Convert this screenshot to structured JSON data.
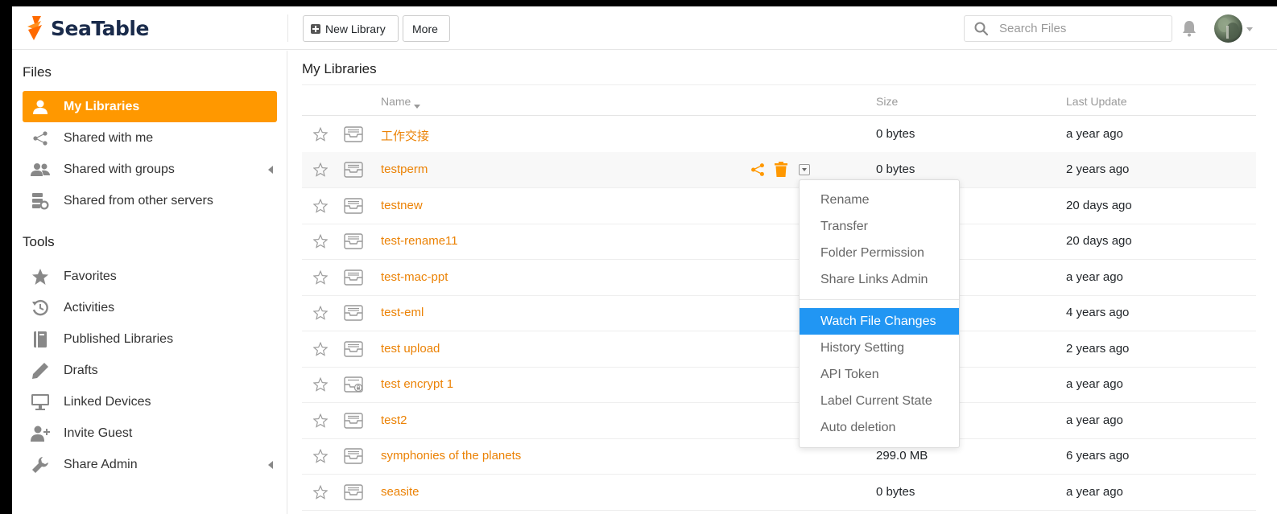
{
  "header": {
    "brand": "SeaTable",
    "new_library_label": "New Library",
    "more_label": "More",
    "search_placeholder": "Search Files"
  },
  "sidebar": {
    "files_heading": "Files",
    "files_items": [
      {
        "label": "My Libraries",
        "icon": "user-icon",
        "active": true
      },
      {
        "label": "Shared with me",
        "icon": "share-icon"
      },
      {
        "label": "Shared with groups",
        "icon": "group-icon"
      },
      {
        "label": "Shared from other servers",
        "icon": "server-share-icon"
      }
    ],
    "tools_heading": "Tools",
    "tools_items": [
      {
        "label": "Favorites",
        "icon": "star-icon"
      },
      {
        "label": "Activities",
        "icon": "history-icon"
      },
      {
        "label": "Published Libraries",
        "icon": "book-icon"
      },
      {
        "label": "Drafts",
        "icon": "pencil-icon"
      },
      {
        "label": "Linked Devices",
        "icon": "monitor-icon"
      },
      {
        "label": "Invite Guest",
        "icon": "add-user-icon"
      },
      {
        "label": "Share Admin",
        "icon": "wrench-icon"
      }
    ]
  },
  "main": {
    "title": "My Libraries",
    "columns": {
      "name": "Name",
      "size": "Size",
      "last_update": "Last Update"
    },
    "rows": [
      {
        "name": "工作交接",
        "size": "0 bytes",
        "updated": "a year ago"
      },
      {
        "name": "testperm",
        "size": "0 bytes",
        "updated": "2 years ago"
      },
      {
        "name": "testnew",
        "size": "",
        "updated": "20 days ago"
      },
      {
        "name": "test-rename11",
        "size": "",
        "updated": "20 days ago"
      },
      {
        "name": "test-mac-ppt",
        "size": "",
        "updated": "a year ago"
      },
      {
        "name": "test-eml",
        "size": "",
        "updated": "4 years ago"
      },
      {
        "name": "test upload",
        "size": "",
        "updated": "2 years ago"
      },
      {
        "name": "test encrypt 1",
        "size": "",
        "updated": "a year ago",
        "encrypted": true
      },
      {
        "name": "test2",
        "size": "",
        "updated": "a year ago"
      },
      {
        "name": "symphonies of the planets",
        "size": "299.0 MB",
        "updated": "6 years ago"
      },
      {
        "name": "seasite",
        "size": "0 bytes",
        "updated": "a year ago"
      }
    ]
  },
  "dropdown": {
    "items": [
      "Rename",
      "Transfer",
      "Folder Permission",
      "Share Links Admin",
      "Watch File Changes",
      "History Setting",
      "API Token",
      "Label Current State",
      "Auto deletion"
    ],
    "active": "Watch File Changes"
  },
  "colors": {
    "accent": "#ff9800",
    "link": "#eb8205",
    "highlight": "#2196f3"
  }
}
